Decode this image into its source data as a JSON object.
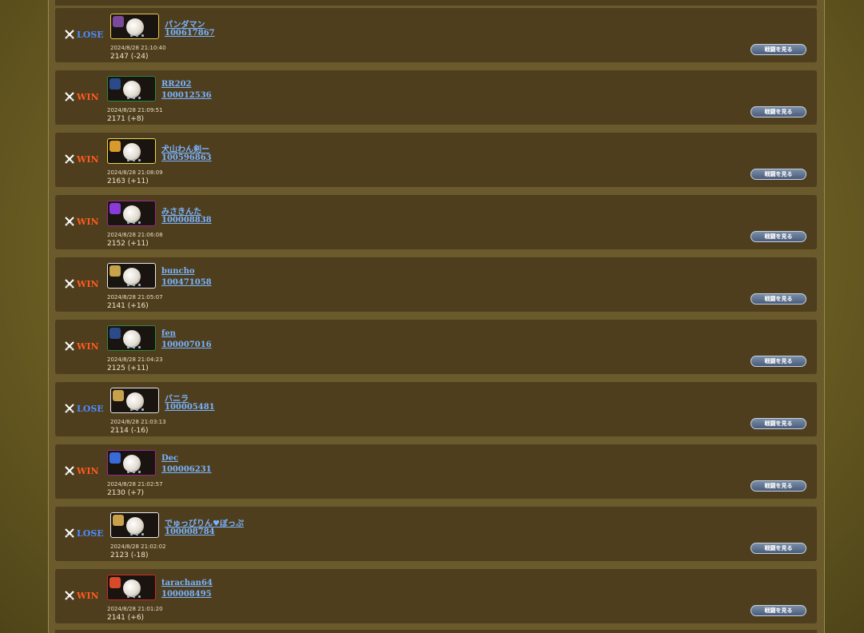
{
  "matches": [
    {
      "result": "LOSE",
      "name": "パンダマン",
      "id": "100617867",
      "date": "2024/8/28 21:10:40",
      "rating": "2147 (-24)",
      "button": "戦闘を見る",
      "frame": "#e8c84a",
      "badge": "#7a4a9a"
    },
    {
      "result": "WIN",
      "name": "RR202",
      "id": "100012536",
      "date": "2024/8/28 21:09:51",
      "rating": "2171 (+8)",
      "button": "戦闘を見る",
      "frame": "#2a8a3a",
      "badge": "#2a4a8a"
    },
    {
      "result": "WIN",
      "name": "犬山わん剣ー",
      "id": "100596863",
      "date": "2024/8/28 21:08:09",
      "rating": "2163 (+11)",
      "button": "戦闘を見る",
      "frame": "#e8d84a",
      "badge": "#d89a2a"
    },
    {
      "result": "WIN",
      "name": "みさきんた",
      "id": "100008838",
      "date": "2024/8/28 21:06:08",
      "rating": "2152 (+11)",
      "button": "戦闘を見る",
      "frame": "#9a2a8a",
      "badge": "#8a3ad8"
    },
    {
      "result": "WIN",
      "name": "buncho",
      "id": "100471058",
      "date": "2024/8/28 21:05:07",
      "rating": "2141 (+16)",
      "button": "戦闘を見る",
      "frame": "#e8e8e8",
      "badge": "#c8a24a"
    },
    {
      "result": "WIN",
      "name": "fen",
      "id": "100007016",
      "date": "2024/8/28 21:04:23",
      "rating": "2125 (+11)",
      "button": "戦闘を見る",
      "frame": "#2a8a3a",
      "badge": "#2a4a8a"
    },
    {
      "result": "LOSE",
      "name": "バニラ",
      "id": "100005481",
      "date": "2024/8/28 21:03:13",
      "rating": "2114 (-16)",
      "button": "戦闘を見る",
      "frame": "#e8e8e8",
      "badge": "#c8a24a"
    },
    {
      "result": "WIN",
      "name": "Dec",
      "id": "100006231",
      "date": "2024/8/28 21:02:57",
      "rating": "2130 (+7)",
      "button": "戦闘を見る",
      "frame": "#9a2a8a",
      "badge": "#3a6ad8"
    },
    {
      "result": "LOSE",
      "name": "でゅっぴりん♥ぼっぷ",
      "id": "100008784",
      "date": "2024/8/28 21:02:02",
      "rating": "2123 (-18)",
      "button": "戦闘を見る",
      "frame": "#e8e8e8",
      "badge": "#c8a24a"
    },
    {
      "result": "WIN",
      "name": "tarachan64",
      "id": "100008495",
      "date": "2024/8/28 21:01:20",
      "rating": "2141 (+6)",
      "button": "戦闘を見る",
      "frame": "#c82a2a",
      "badge": "#d84a2a"
    }
  ]
}
